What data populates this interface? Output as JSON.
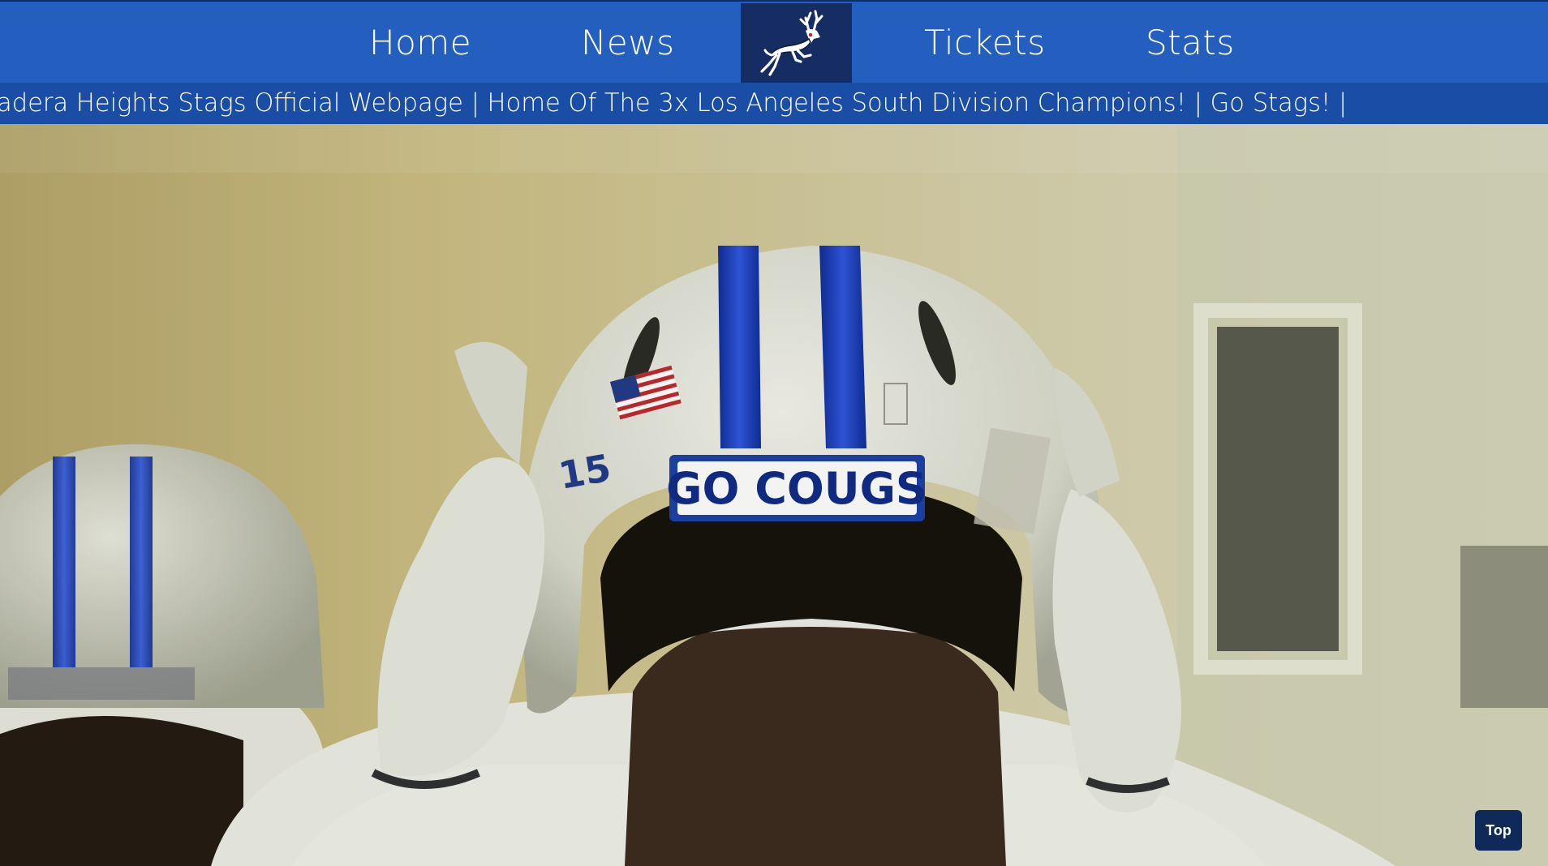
{
  "nav": {
    "home_label": "Home",
    "news_label": "News",
    "tickets_label": "Tickets",
    "stats_label": "Stats",
    "logo_icon": "stag-icon"
  },
  "ticker": {
    "text": "adera Heights Stags Official Webpage | Home Of The 3x Los Angeles South Division Champions! | Go Stags! |"
  },
  "hero": {
    "helmet_decal": "GO COUGS",
    "helmet_number": "15"
  },
  "top_button": {
    "label": "Top"
  },
  "colors": {
    "nav_bg": "#245fc0",
    "ticker_bg": "#1a4ea6",
    "logo_bg": "#152d63",
    "top_button_bg": "#0f2a58"
  }
}
